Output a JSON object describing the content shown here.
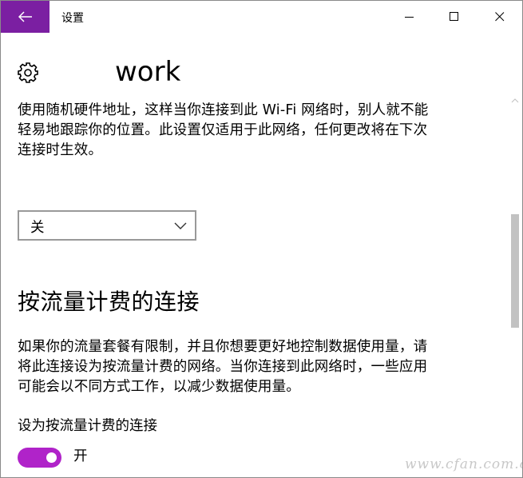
{
  "window": {
    "title": "设置",
    "back_icon": "arrow-left-icon",
    "accent_color": "#7b1fa2",
    "controls": {
      "minimize_icon": "minimize-icon",
      "maximize_icon": "maximize-icon",
      "close_icon": "close-icon"
    }
  },
  "header": {
    "icon": "gear-icon",
    "title": "work"
  },
  "random_hw_address": {
    "description_lines": [
      "使用随机硬件地址，这样当你连接到此 Wi-Fi 网络时，别人就不能",
      "轻易地跟踪你的位置。此设置仅适用于此网络，任何更改将在下次",
      "连接时生效。"
    ],
    "dropdown": {
      "selected": "关",
      "icon": "chevron-down-icon"
    }
  },
  "metered": {
    "heading": "按流量计费的连接",
    "description_lines": [
      "如果你的流量套餐有限制，并且你想要更好地控制数据使用量，请",
      "将此连接设为按流量计费的网络。当你连接到此网络时，一些应用",
      "可能会以不同方式工作，以减少数据使用量。"
    ],
    "toggle_label": "设为按流量计费的连接",
    "toggle_state": "开",
    "toggle_on": true,
    "toggle_color": "#b023c9"
  },
  "watermark": "www.cfan.com.cn"
}
